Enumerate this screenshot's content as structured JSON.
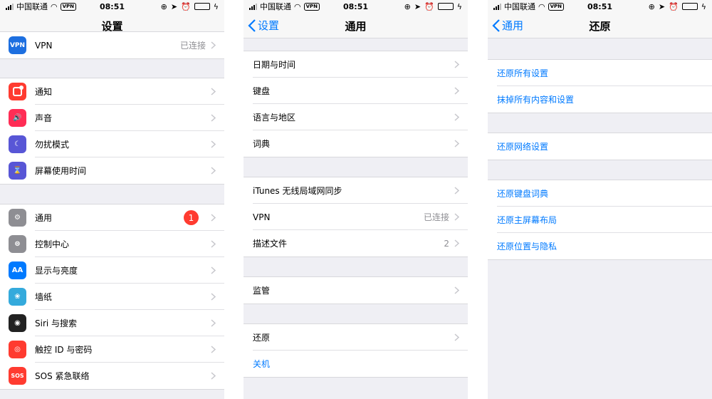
{
  "status": {
    "carrier": "中国联通",
    "time": "08:51",
    "vpn": "VPN"
  },
  "colors": {
    "accent": "#007aff",
    "badge": "#ff3b30",
    "battery": "#4cd964"
  },
  "settings": {
    "title": "设置",
    "vpn": {
      "icon_text": "VPN",
      "label": "VPN",
      "detail": "已连接",
      "icon": "vpn-icon"
    },
    "group2": [
      {
        "label": "通知",
        "icon": "notifications-icon",
        "color": "#ff3b30"
      },
      {
        "label": "声音",
        "icon": "sound-icon",
        "color": "#ff2d55"
      },
      {
        "label": "勿扰模式",
        "icon": "moon-icon",
        "color": "#5856d6"
      },
      {
        "label": "屏幕使用时间",
        "icon": "hourglass-icon",
        "color": "#5856d6"
      }
    ],
    "group3": [
      {
        "label": "通用",
        "icon": "gear-icon",
        "color": "#8e8e93",
        "badge": "1"
      },
      {
        "label": "控制中心",
        "icon": "toggles-icon",
        "color": "#8e8e93"
      },
      {
        "label": "显示与亮度",
        "icon": "display-icon",
        "color": "#007aff",
        "icon_text": "AA"
      },
      {
        "label": "墙纸",
        "icon": "wallpaper-icon",
        "color": "#34aadc"
      },
      {
        "label": "Siri 与搜索",
        "icon": "siri-icon",
        "color": "#222222"
      },
      {
        "label": "触控 ID 与密码",
        "icon": "fingerprint-icon",
        "color": "#ff3b30"
      },
      {
        "label": "SOS 紧急联络",
        "icon": "sos-icon",
        "color": "#ff3b30",
        "icon_text": "SOS"
      }
    ]
  },
  "general": {
    "back": "设置",
    "title": "通用",
    "group1": [
      {
        "label": "日期与时间"
      },
      {
        "label": "键盘"
      },
      {
        "label": "语言与地区"
      },
      {
        "label": "词典"
      }
    ],
    "group2": [
      {
        "label": "iTunes 无线局域网同步"
      },
      {
        "label": "VPN",
        "detail": "已连接"
      },
      {
        "label": "描述文件",
        "detail": "2"
      }
    ],
    "group3": [
      {
        "label": "监管"
      }
    ],
    "group4": [
      {
        "label": "还原"
      },
      {
        "label": "关机"
      }
    ]
  },
  "reset": {
    "back": "通用",
    "title": "还原",
    "group1": [
      {
        "label": "还原所有设置"
      },
      {
        "label": "抹掉所有内容和设置"
      }
    ],
    "group2": [
      {
        "label": "还原网络设置"
      }
    ],
    "group3": [
      {
        "label": "还原键盘词典"
      },
      {
        "label": "还原主屏幕布局"
      },
      {
        "label": "还原位置与隐私"
      }
    ]
  }
}
